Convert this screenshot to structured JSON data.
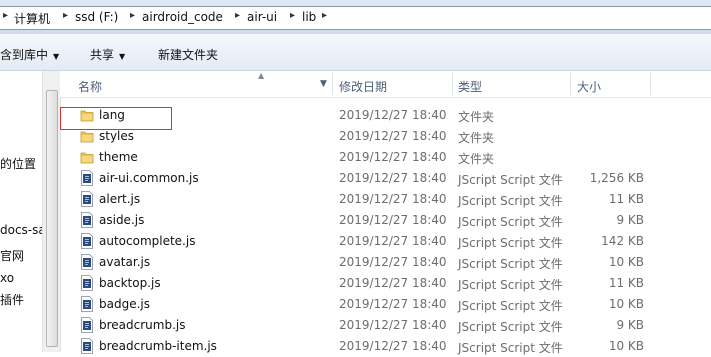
{
  "address": {
    "crumbs": [
      "计算机",
      "ssd (F:)",
      "airdroid_code",
      "air-ui",
      "lib"
    ],
    "separator": "▸"
  },
  "toolbar": {
    "include_label": "含到库中",
    "share_label": "共享",
    "new_folder_label": "新建文件夹"
  },
  "nav": {
    "items": [
      "的位置",
      "docs-sa",
      "官网",
      "xo",
      "插件"
    ]
  },
  "columns": {
    "name": "名称",
    "date": "修改日期",
    "type": "类型",
    "size": "大小"
  },
  "files": [
    {
      "name": "lang",
      "date": "2019/12/27 18:40",
      "type": "文件夹",
      "size": "",
      "icon": "folder-icon"
    },
    {
      "name": "styles",
      "date": "2019/12/27 18:40",
      "type": "文件夹",
      "size": "",
      "icon": "folder-icon"
    },
    {
      "name": "theme",
      "date": "2019/12/27 18:40",
      "type": "文件夹",
      "size": "",
      "icon": "folder-icon"
    },
    {
      "name": "air-ui.common.js",
      "date": "2019/12/27 18:40",
      "type": "JScript Script 文件",
      "size": "1,256 KB",
      "icon": "jscript-file-icon"
    },
    {
      "name": "alert.js",
      "date": "2019/12/27 18:40",
      "type": "JScript Script 文件",
      "size": "11 KB",
      "icon": "jscript-file-icon"
    },
    {
      "name": "aside.js",
      "date": "2019/12/27 18:40",
      "type": "JScript Script 文件",
      "size": "9 KB",
      "icon": "jscript-file-icon"
    },
    {
      "name": "autocomplete.js",
      "date": "2019/12/27 18:40",
      "type": "JScript Script 文件",
      "size": "142 KB",
      "icon": "jscript-file-icon"
    },
    {
      "name": "avatar.js",
      "date": "2019/12/27 18:40",
      "type": "JScript Script 文件",
      "size": "10 KB",
      "icon": "jscript-file-icon"
    },
    {
      "name": "backtop.js",
      "date": "2019/12/27 18:40",
      "type": "JScript Script 文件",
      "size": "11 KB",
      "icon": "jscript-file-icon"
    },
    {
      "name": "badge.js",
      "date": "2019/12/27 18:40",
      "type": "JScript Script 文件",
      "size": "10 KB",
      "icon": "jscript-file-icon"
    },
    {
      "name": "breadcrumb.js",
      "date": "2019/12/27 18:40",
      "type": "JScript Script 文件",
      "size": "9 KB",
      "icon": "jscript-file-icon"
    },
    {
      "name": "breadcrumb-item.js",
      "date": "2019/12/27 18:40",
      "type": "JScript Script 文件",
      "size": "10 KB",
      "icon": "jscript-file-icon"
    }
  ],
  "highlight_color": "#d9342b"
}
